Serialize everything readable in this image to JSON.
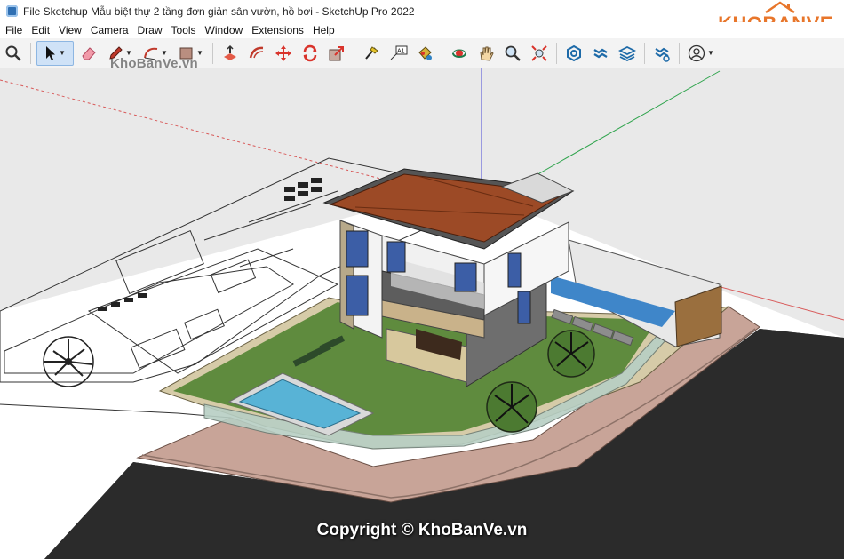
{
  "window": {
    "title": "File Sketchup Mẫu biệt thự 2 tầng đơn giản sân vườn, hồ bơi - SketchUp Pro 2022"
  },
  "logo": {
    "text": "KHOBANVE",
    "color": "#e8762b"
  },
  "menu": {
    "items": [
      "File",
      "Edit",
      "View",
      "Camera",
      "Draw",
      "Tools",
      "Window",
      "Extensions",
      "Help"
    ]
  },
  "toolbar": {
    "tools": [
      "search-tool",
      "select-tool",
      "eraser-tool",
      "pencil-tool",
      "arc-tool",
      "rectangle-tool",
      "push-pull-tool",
      "offset-tool",
      "move-tool",
      "rotate-tool",
      "scale-tool",
      "tape-measure-tool",
      "text-tool",
      "paint-bucket-tool",
      "orbit-tool",
      "pan-tool",
      "zoom-tool",
      "zoom-extents-tool",
      "warehouse-tool",
      "extension-warehouse-tool",
      "layout-tool",
      "extension-manager-tool",
      "account-tool"
    ]
  },
  "watermarks": {
    "top": "KhoBanVe.vn",
    "bottom": "Copyright © KhoBanVe.vn"
  },
  "colors": {
    "roof": "#9c4a26",
    "lawn": "#5e8a3c",
    "pool": "#5ab4d6",
    "wall": "#d9cfae",
    "road": "#2b2b2b",
    "sidewalk": "#c9a79a",
    "house": "#f1f1f1",
    "gray_block": "#6b6b6b"
  }
}
